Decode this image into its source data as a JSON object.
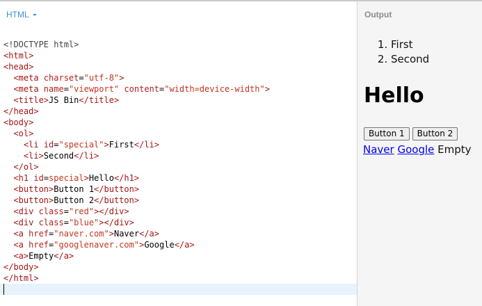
{
  "editor": {
    "language": "HTML",
    "lines": [
      "<!DOCTYPE html>",
      "<html>",
      "<head>",
      "  <meta charset=\"utf-8\">",
      "  <meta name=\"viewport\" content=\"width=device-width\">",
      "  <title>JS Bin</title>",
      "</head>",
      "<body>",
      "  <ol>",
      "    <li id=\"special\">First</li>",
      "    <li>Second</li>",
      "  </ol>",
      "  <h1 id=special>Hello</h1>",
      "  <button>Button 1</button>",
      "  <button>Button 2</button>",
      "  <div class=\"red\"></div>",
      "  <div class=\"blue\"></div>",
      "  <a href=\"naver.com\">Naver</a>",
      "  <a href=\"googlenaver.com\">Google</a>",
      "  <a>Empty</a>",
      "</body>",
      "</html>"
    ]
  },
  "output": {
    "title": "Output",
    "list": [
      "First",
      "Second"
    ],
    "heading": "Hello",
    "buttons": [
      "Button 1",
      "Button 2"
    ],
    "links": [
      "Naver",
      "Google"
    ],
    "empty_text": "Empty"
  }
}
